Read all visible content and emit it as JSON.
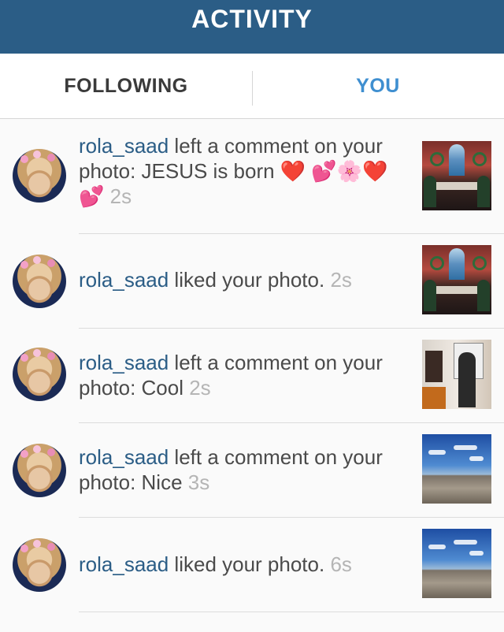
{
  "header": {
    "title": "ACTIVITY"
  },
  "tabs": {
    "following": "FOLLOWING",
    "you": "YOU"
  },
  "rows": [
    {
      "user": "rola_saad",
      "action": " left a comment on your photo: JESUS is born ",
      "emoji": "❤️ 💕🌸❤️💕",
      "time": "2s",
      "photo": "church"
    },
    {
      "user": "rola_saad",
      "action": " liked your photo. ",
      "time": "2s",
      "photo": "church"
    },
    {
      "user": "rola_saad",
      "action": " left a comment on your photo: Cool ",
      "time": "2s",
      "photo": "gallery"
    },
    {
      "user": "rola_saad",
      "action": " left a comment on your photo: Nice ",
      "time": "3s",
      "photo": "field"
    },
    {
      "user": "rola_saad",
      "action": " liked your photo. ",
      "time": "6s",
      "photo": "field"
    }
  ],
  "colors": {
    "header_bg": "#2b5d86",
    "username": "#2b5d86",
    "active_tab": "#3f8fd0",
    "timestamp": "#b5b5b5"
  }
}
